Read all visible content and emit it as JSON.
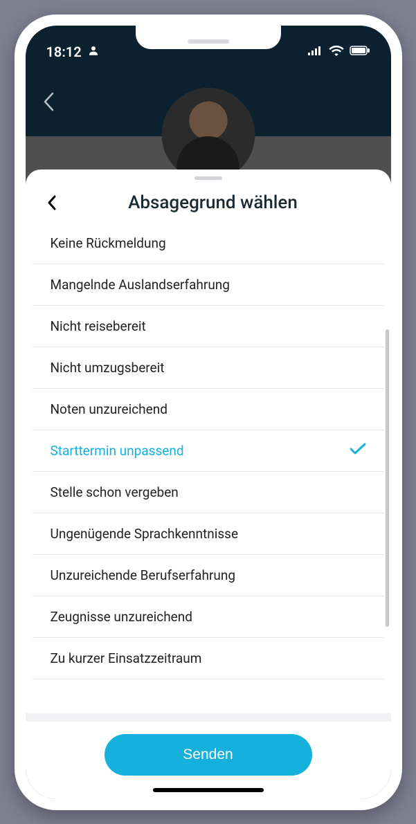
{
  "status": {
    "time": "18:12"
  },
  "sheet": {
    "title": "Absagegrund wählen",
    "items": [
      {
        "label": "Keine Rückmeldung",
        "selected": false
      },
      {
        "label": "Mangelnde Auslandserfahrung",
        "selected": false
      },
      {
        "label": "Nicht reisebereit",
        "selected": false
      },
      {
        "label": "Nicht umzugsbereit",
        "selected": false
      },
      {
        "label": "Noten unzureichend",
        "selected": false
      },
      {
        "label": "Starttermin unpassend",
        "selected": true
      },
      {
        "label": "Stelle schon vergeben",
        "selected": false
      },
      {
        "label": "Ungenügende Sprachkenntnisse",
        "selected": false
      },
      {
        "label": "Unzureichende Berufserfahrung",
        "selected": false
      },
      {
        "label": "Zeugnisse unzureichend",
        "selected": false
      },
      {
        "label": "Zu kurzer Einsatzzeitraum",
        "selected": false
      }
    ],
    "send_label": "Senden"
  },
  "colors": {
    "accent": "#16b0dd"
  }
}
